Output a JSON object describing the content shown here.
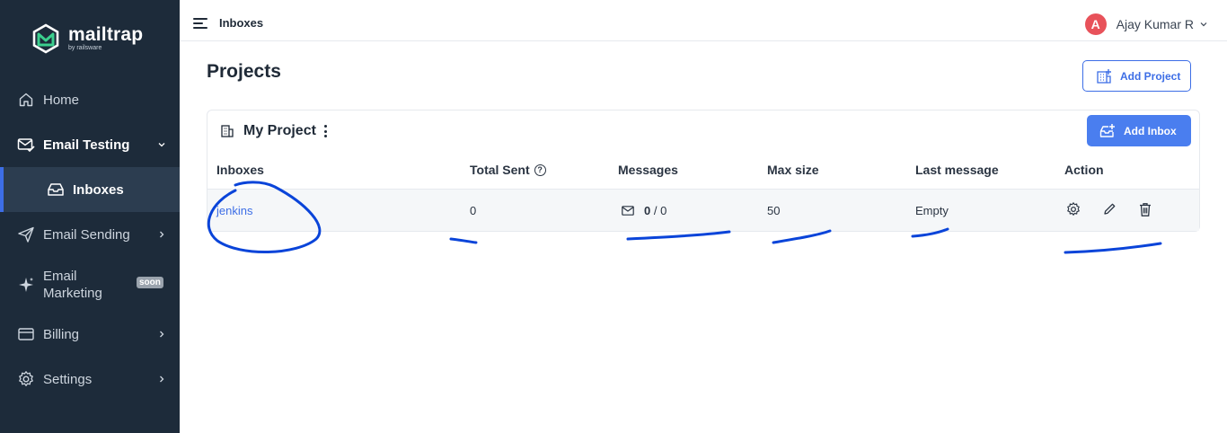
{
  "brand": {
    "name": "mailtrap",
    "sub": "by railsware"
  },
  "sidebar": {
    "items": [
      {
        "label": "Home"
      },
      {
        "label": "Email Testing"
      },
      {
        "label": "Inboxes"
      },
      {
        "label": "Email Sending"
      },
      {
        "label": "Email Marketing",
        "line1": "Email",
        "line2": "Marketing",
        "badge": "soon"
      },
      {
        "label": "Billing"
      },
      {
        "label": "Settings"
      }
    ]
  },
  "header": {
    "breadcrumb": "Inboxes",
    "user": {
      "initial": "A",
      "name": "Ajay Kumar R"
    }
  },
  "main": {
    "title": "Projects",
    "add_project_label": "Add Project",
    "project": {
      "name": "My Project",
      "add_inbox_label": "Add Inbox",
      "columns": [
        "Inboxes",
        "Total Sent",
        "Messages",
        "Max size",
        "Last message",
        "Action"
      ],
      "help_glyph": "?",
      "rows": [
        {
          "inbox": "jenkins",
          "total_sent": "0",
          "messages_unread": "0",
          "messages_total": "/ 0",
          "max_size": "50",
          "last_message": "Empty"
        }
      ]
    }
  },
  "colors": {
    "sidebar_bg": "#1d2b3a",
    "accent": "#3d6ee6",
    "primary_button": "#4a7eef",
    "avatar": "#e8525a",
    "annotation_ink": "#0a44d9",
    "logo_green": "#3ccf8e"
  },
  "icons": [
    "home-icon",
    "email-testing-icon",
    "inbox-icon",
    "send-icon",
    "sparkle-icon",
    "billing-icon",
    "gear-icon",
    "building-icon",
    "envelope-icon",
    "pencil-icon",
    "trash-icon",
    "chevron-down-icon",
    "chevron-right-icon"
  ]
}
